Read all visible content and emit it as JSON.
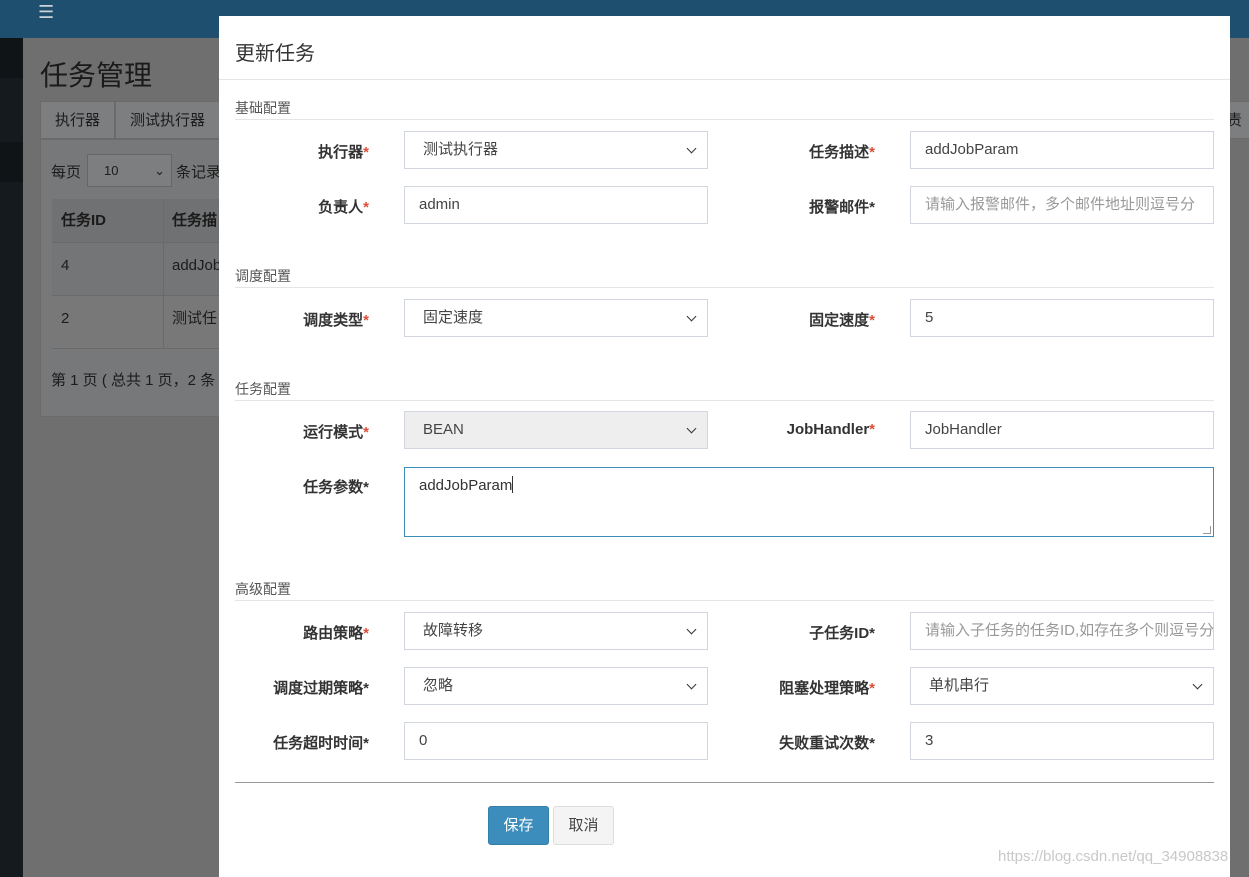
{
  "background": {
    "page_title": "任务管理",
    "tabs": [
      "执行器",
      "测试执行器"
    ],
    "right_tab_label": "责人",
    "per_page_label": "每页",
    "per_page_value": "10",
    "records_label": "条记录",
    "table": {
      "headers": [
        "任务ID",
        "任务描"
      ],
      "rows": [
        [
          "4",
          "addJob"
        ],
        [
          "2",
          "测试任"
        ]
      ]
    },
    "pager_text": "第 1 页 ( 总共 1 页，2 条"
  },
  "modal": {
    "title": "更新任务",
    "sections": {
      "basic": "基础配置",
      "schedule": "调度配置",
      "task": "任务配置",
      "advanced": "高级配置"
    },
    "fields": {
      "executor": {
        "label": "执行器",
        "value": "测试执行器"
      },
      "job_desc": {
        "label": "任务描述",
        "value": "addJobParam"
      },
      "author": {
        "label": "负责人",
        "value": "admin"
      },
      "alarm_email": {
        "label": "报警邮件*",
        "placeholder": "请输入报警邮件，多个邮件地址则逗号分"
      },
      "schedule_type": {
        "label": "调度类型",
        "value": "固定速度"
      },
      "fixed_rate": {
        "label": "固定速度",
        "value": "5"
      },
      "glue_type": {
        "label": "运行模式",
        "value": "BEAN"
      },
      "job_handler": {
        "label": "JobHandler",
        "value": "JobHandler"
      },
      "job_param": {
        "label": "任务参数*",
        "value": "addJobParam"
      },
      "route_strategy": {
        "label": "路由策略",
        "value": "故障转移"
      },
      "child_job_id": {
        "label": "子任务ID*",
        "placeholder": "请输入子任务的任务ID,如存在多个则逗号分"
      },
      "misfire_strategy": {
        "label": "调度过期策略*",
        "value": "忽略"
      },
      "block_strategy": {
        "label": "阻塞处理策略",
        "value": "单机串行"
      },
      "timeout": {
        "label": "任务超时时间*",
        "value": "0"
      },
      "fail_retry": {
        "label": "失败重试次数*",
        "value": "3"
      }
    },
    "buttons": {
      "save": "保存",
      "cancel": "取消"
    },
    "required_mark": "*"
  },
  "watermark": "https://blog.csdn.net/qq_34908838"
}
